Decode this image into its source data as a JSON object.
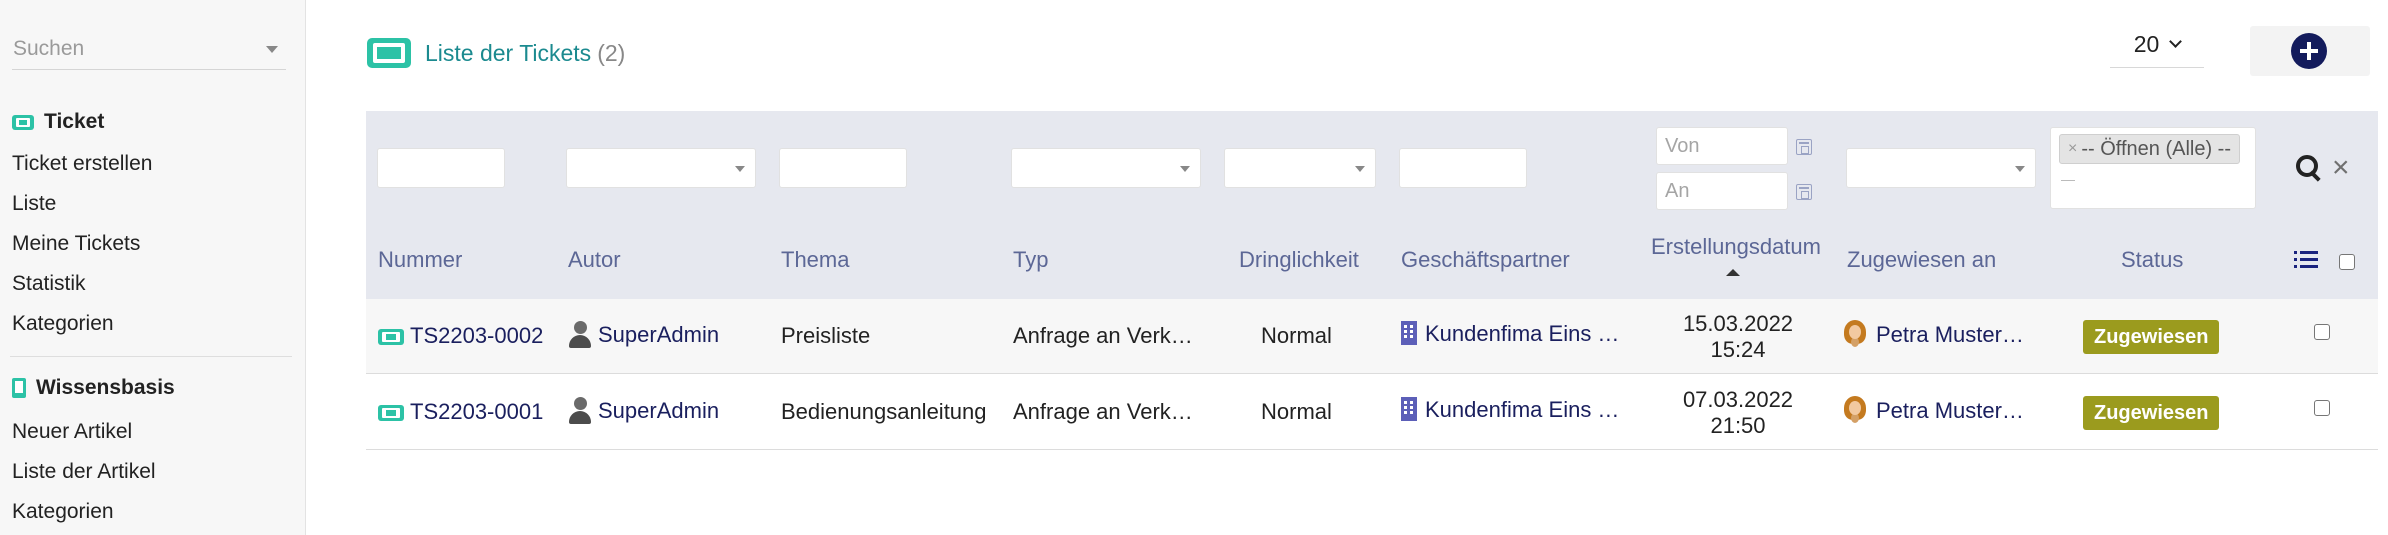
{
  "sidebar": {
    "search_placeholder": "Suchen",
    "sections": [
      {
        "title": "Ticket",
        "items": [
          "Ticket erstellen",
          "Liste",
          "Meine Tickets",
          "Statistik",
          "Kategorien"
        ]
      },
      {
        "title": "Wissensbasis",
        "items": [
          "Neuer Artikel",
          "Liste der Artikel",
          "Kategorien"
        ]
      }
    ]
  },
  "header": {
    "title": "Liste der Tickets",
    "count": "(2)",
    "per_page": "20"
  },
  "filters": {
    "date_from_placeholder": "Von",
    "date_to_placeholder": "An",
    "status_chip": "-- Öffnen (Alle) --",
    "status_chip_remove": "×",
    "clear": "×"
  },
  "columns": [
    "Nummer",
    "Autor",
    "Thema",
    "Typ",
    "Dringlichkeit",
    "Geschäftspartner",
    "Erstellungsdatum",
    "Zugewiesen an",
    "Status"
  ],
  "rows": [
    {
      "number": "TS2203-0002",
      "author": "SuperAdmin",
      "subject": "Preisliste",
      "type": "Anfrage an Verk…",
      "urgency": "Normal",
      "partner": "Kundenfima Eins …",
      "date": "15.03.2022",
      "time": "15:24",
      "assignee": "Petra Muster…",
      "status": "Zugewiesen"
    },
    {
      "number": "TS2203-0001",
      "author": "SuperAdmin",
      "subject": "Bedienungsanleitung",
      "type": "Anfrage an Verk…",
      "urgency": "Normal",
      "partner": "Kundenfima Eins …",
      "date": "07.03.2022",
      "time": "21:50",
      "assignee": "Petra Muster…",
      "status": "Zugewiesen"
    }
  ],
  "icons": {
    "ticket": "ticket-icon",
    "knowledge": "book-icon",
    "add": "plus-circle-icon",
    "search": "search-icon",
    "columns": "list-icon",
    "author": "user-avatar-icon",
    "partner": "building-icon",
    "assignee": "user-avatar-icon",
    "calendar": "calendar-icon"
  },
  "colors": {
    "accent": "#2cc2a6",
    "title": "#1b8a8f",
    "link": "#1a1f5e",
    "header_text": "#5c6796",
    "status_badge": "#9b9b1e",
    "add_button": "#131b5c"
  }
}
